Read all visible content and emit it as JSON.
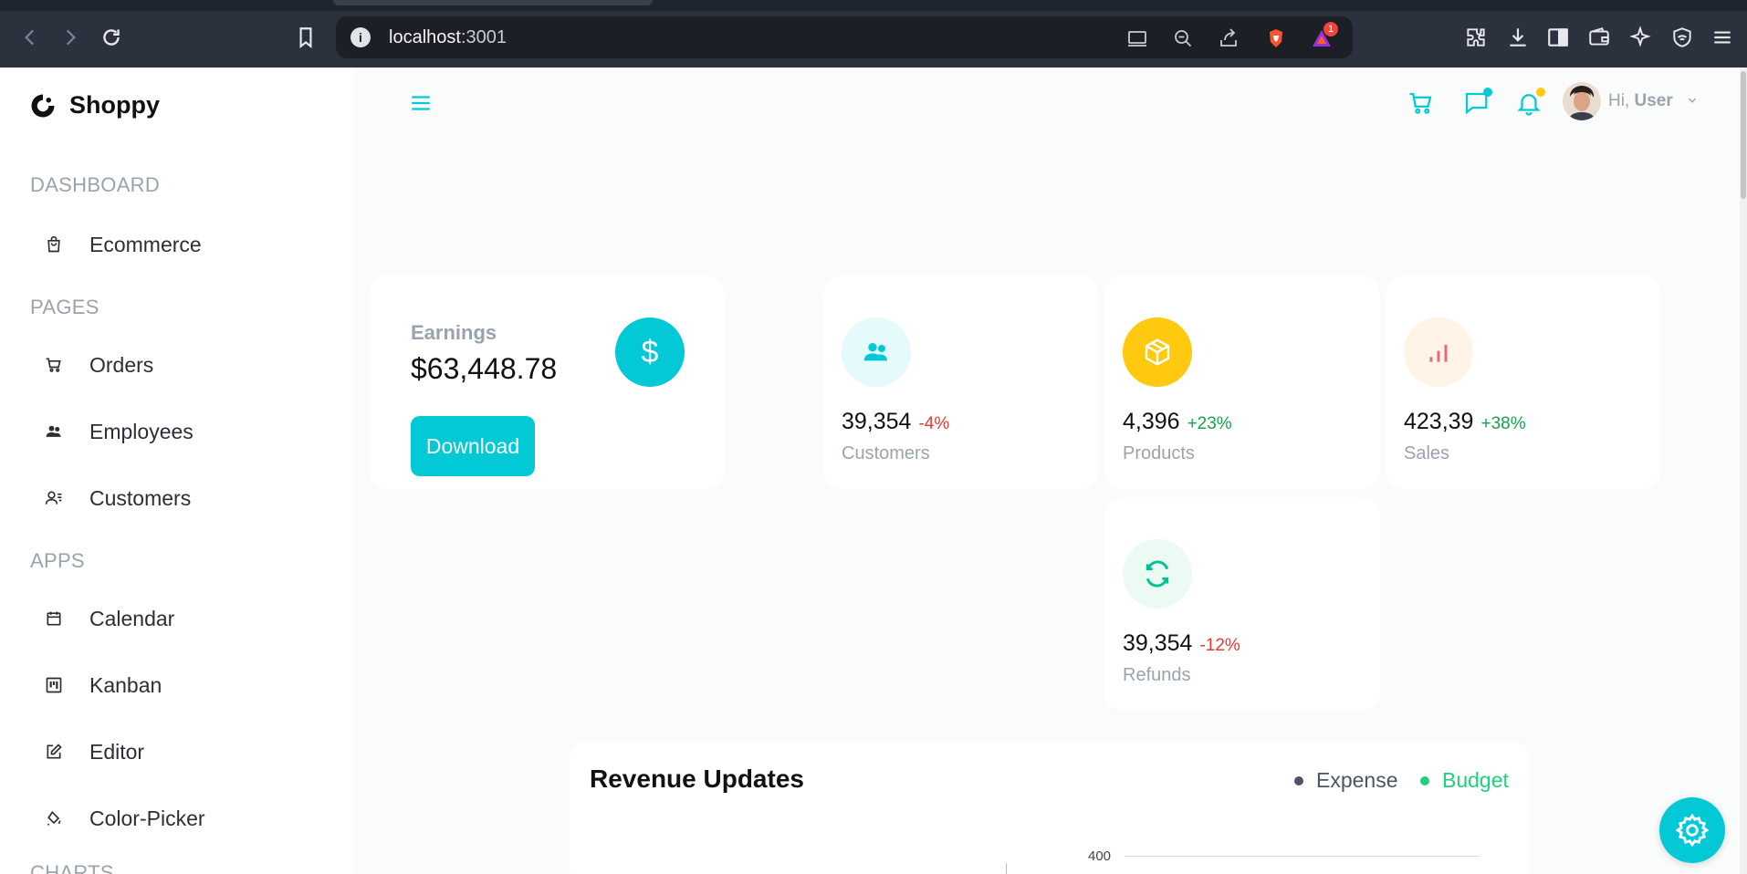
{
  "browser": {
    "url_host": "localhost",
    "url_port": ":3001",
    "notification_count": "1"
  },
  "sidebar": {
    "brand": "Shoppy",
    "sections": [
      {
        "title": "DASHBOARD"
      },
      {
        "title": "PAGES"
      },
      {
        "title": "APPS"
      }
    ],
    "items": [
      {
        "label": "Ecommerce",
        "icon": "shopping-bag-icon"
      },
      {
        "label": "Orders",
        "icon": "cart-icon"
      },
      {
        "label": "Employees",
        "icon": "employees-icon"
      },
      {
        "label": "Customers",
        "icon": "customers-icon"
      },
      {
        "label": "Calendar",
        "icon": "calendar-icon"
      },
      {
        "label": "Kanban",
        "icon": "kanban-icon"
      },
      {
        "label": "Editor",
        "icon": "edit-icon"
      },
      {
        "label": "Color-Picker",
        "icon": "paint-bucket-icon"
      }
    ],
    "next_section_partial": "CHARTS"
  },
  "header": {
    "greeting": "Hi,",
    "username": "User"
  },
  "earnings": {
    "title": "Earnings",
    "value": "$63,448.78",
    "icon": "$",
    "download_label": "Download"
  },
  "stats": [
    {
      "value": "39,354",
      "change": "-4%",
      "label": "Customers",
      "icon": "users-icon",
      "icon_color": "#03c9d7",
      "icon_bg": "#e5fafb",
      "change_color": "#e53935"
    },
    {
      "value": "4,396",
      "change": "+23%",
      "label": "Products",
      "icon": "box-icon",
      "icon_color": "#ffffff",
      "icon_bg": "#fec90f",
      "change_color": "#16a34a"
    },
    {
      "value": "423,39",
      "change": "+38%",
      "label": "Sales",
      "icon": "bar-chart-icon",
      "icon_color": "#e46a76",
      "icon_bg": "#fff4e5",
      "change_color": "#16a34a"
    },
    {
      "value": "39,354",
      "change": "-12%",
      "label": "Refunds",
      "icon": "refresh-icon",
      "icon_color": "#00c292",
      "icon_bg": "#ebfaf2",
      "change_color": "#e53935"
    }
  ],
  "revenue": {
    "title": "Revenue Updates",
    "legend": [
      {
        "label": "Expense",
        "color": "#4b5563"
      },
      {
        "label": "Budget",
        "color": "#1fd17a"
      }
    ],
    "axis_top_label": "400"
  },
  "colors": {
    "accent": "#03c9d7"
  }
}
